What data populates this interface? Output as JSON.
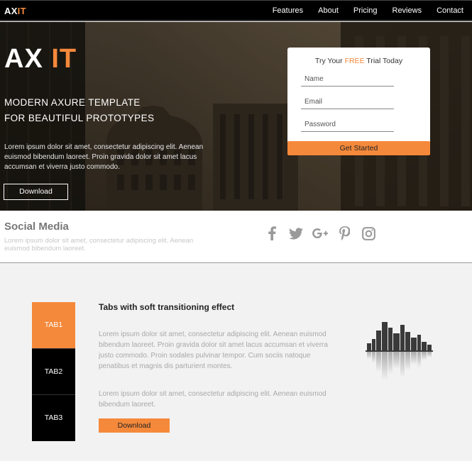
{
  "nav": {
    "logo_main": "AX",
    "logo_accent": "IT",
    "links": [
      "Features",
      "About",
      "Pricing",
      "Reviews",
      "Contact"
    ]
  },
  "hero": {
    "title_main": "AX",
    "title_accent": "IT",
    "subtitle_line1": "MODERN AXURE TEMPLATE",
    "subtitle_line2": "FOR BEAUTIFUL PROTOTYPES",
    "body": "Lorem ipsum dolor sit amet, consectetur adipiscing elit. Aenean euismod bibendum laoreet. Proin gravida dolor sit amet lacus accumsan et viverra justo commodo.",
    "download_label": "Download"
  },
  "trial_form": {
    "title_before": "Try Your ",
    "title_accent": "FREE",
    "title_after": " Trial Today",
    "name_placeholder": "Name",
    "email_placeholder": "Email",
    "password_placeholder": "Password",
    "submit_label": "Get Started"
  },
  "social": {
    "title": "Social Media",
    "body": "Lorem ipsum dolor sit amet, consectetur adipiscing elit. Aenean euismod bibendum laoreet.",
    "icons": [
      "facebook-icon",
      "twitter-icon",
      "google-plus-icon",
      "pinterest-icon",
      "instagram-icon"
    ]
  },
  "tabs": {
    "items": [
      "TAB1",
      "TAB2",
      "TAB3"
    ],
    "heading": "Tabs with soft transitioning effect",
    "paragraph1": "Lorem ipsum dolor sit amet, consectetur adipiscing elit. Aenean euismod bibendum laoreet. Proin gravida dolor sit amet lacus accumsan et viverra justo commodo. Proin sodales pulvinar tempor. Cum sociis natoque penatibus et magnis dis parturient montes.",
    "paragraph2": "Lorem ipsum dolor sit amet, consectetur adipiscing elit. Aenean euismod bibendum laoreet.",
    "download_label": "Download"
  },
  "colors": {
    "accent": "#f5893b",
    "nav_bg": "#000000",
    "section_bg": "#f2f2f2"
  }
}
